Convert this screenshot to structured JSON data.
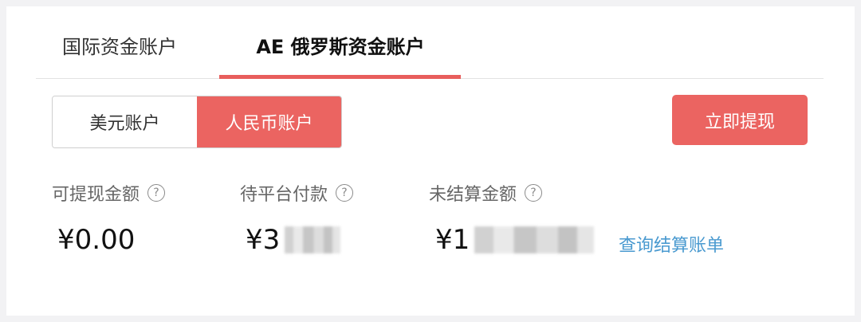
{
  "tabs": [
    {
      "label": "国际资金账户"
    },
    {
      "label": "AE 俄罗斯资金账户",
      "active": true
    }
  ],
  "currency_switch": {
    "options": [
      "美元账户",
      "人民币账户"
    ],
    "selected": "人民币账户"
  },
  "withdraw_button": {
    "label": "立即提现"
  },
  "balances": [
    {
      "label": "可提现金额",
      "amount": "¥0.00"
    },
    {
      "label": "待平台付款",
      "amount": "¥3"
    },
    {
      "label": "未结算金额",
      "amount": "¥1"
    }
  ],
  "help_glyph": "?",
  "settlement_link": {
    "label": "查询结算账单"
  },
  "colors": {
    "accent": "#eb6461",
    "link": "#4a9ad0",
    "text": "#333333",
    "muted": "#666666"
  },
  "icons": {
    "help": "question-circle-icon"
  }
}
